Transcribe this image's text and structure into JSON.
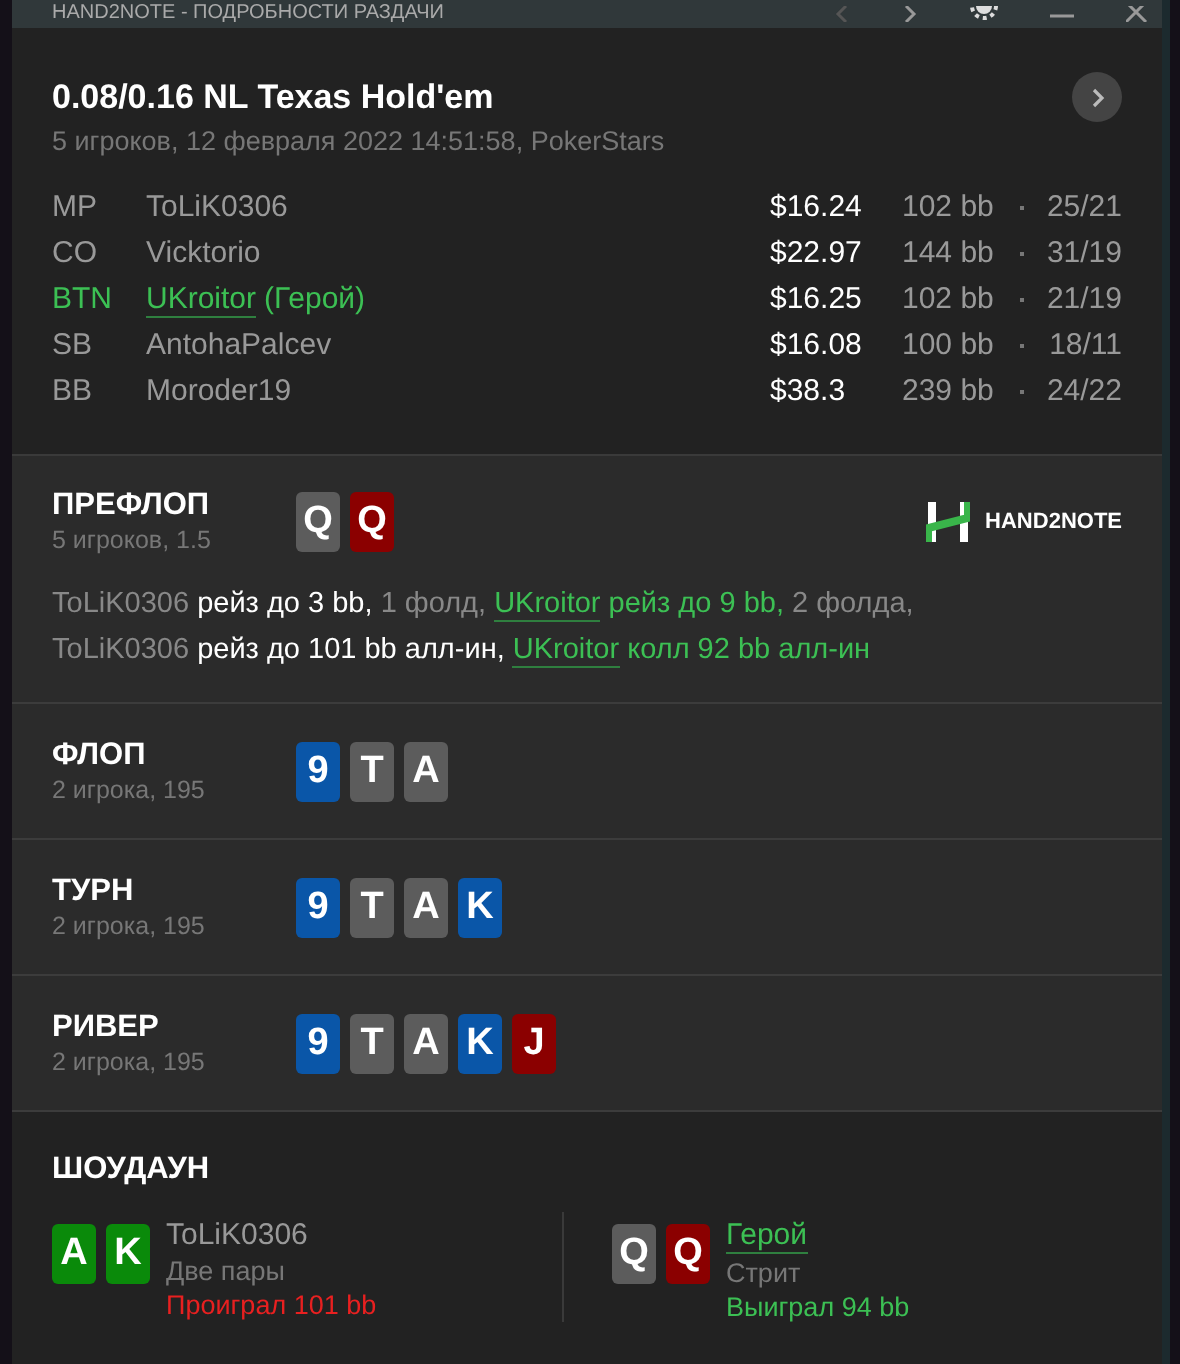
{
  "window": {
    "title": "HAND2NOTE - ПОДРОБНОСТИ РАЗДАЧИ"
  },
  "header": {
    "title": "0.08/0.16 NL Texas Hold'em",
    "subtitle": "5 игроков, 12 февраля 2022 14:51:58, PokerStars"
  },
  "players": [
    {
      "position": "MP",
      "name": "ToLiK0306",
      "hero": false,
      "stack": "$16.24",
      "bb": "102 bb",
      "stats": "25/21"
    },
    {
      "position": "CO",
      "name": "Vicktorio",
      "hero": false,
      "stack": "$22.97",
      "bb": "144 bb",
      "stats": "31/19"
    },
    {
      "position": "BTN",
      "name": "UKroitor",
      "hero": true,
      "hero_label": "(Герой)",
      "stack": "$16.25",
      "bb": "102 bb",
      "stats": "21/19"
    },
    {
      "position": "SB",
      "name": "AntohaPalcev",
      "hero": false,
      "stack": "$16.08",
      "bb": "100 bb",
      "stats": "18/11"
    },
    {
      "position": "BB",
      "name": "Moroder19",
      "hero": false,
      "stack": "$38.3",
      "bb": "239 bb",
      "stats": "24/22"
    }
  ],
  "preflop": {
    "title": "ПРЕФЛОП",
    "subtitle": "5 игроков, 1.5",
    "cards": [
      {
        "rank": "Q",
        "color": "#5c5c5c"
      },
      {
        "rank": "Q",
        "color": "#8b0000"
      }
    ],
    "logo": "HAND2NOTE",
    "action_lines": [
      [
        {
          "kind": "player",
          "text": "ToLiK0306"
        },
        {
          "kind": "action",
          "text": "рейз до 3 bb,"
        },
        {
          "kind": "fold",
          "text": "1 фолд,"
        },
        {
          "kind": "hero",
          "text": "UKroitor"
        },
        {
          "kind": "hero_action",
          "text": "рейз до 9 bb,"
        },
        {
          "kind": "fold",
          "text": "2 фолда,"
        }
      ],
      [
        {
          "kind": "player",
          "text": "ToLiK0306"
        },
        {
          "kind": "action",
          "text": "рейз до 101 bb алл-ин,"
        },
        {
          "kind": "hero",
          "text": "UKroitor"
        },
        {
          "kind": "hero_action",
          "text": "колл 92 bb алл-ин"
        }
      ]
    ]
  },
  "streets": [
    {
      "title": "ФЛОП",
      "subtitle": "2 игрока, 195",
      "cards": [
        {
          "rank": "9",
          "color": "#0a56a8"
        },
        {
          "rank": "T",
          "color": "#5c5c5c"
        },
        {
          "rank": "A",
          "color": "#5c5c5c"
        }
      ]
    },
    {
      "title": "ТУРН",
      "subtitle": "2 игрока, 195",
      "cards": [
        {
          "rank": "9",
          "color": "#0a56a8"
        },
        {
          "rank": "T",
          "color": "#5c5c5c"
        },
        {
          "rank": "A",
          "color": "#5c5c5c"
        },
        {
          "rank": "K",
          "color": "#0a56a8"
        }
      ]
    },
    {
      "title": "РИВЕР",
      "subtitle": "2 игрока, 195",
      "cards": [
        {
          "rank": "9",
          "color": "#0a56a8"
        },
        {
          "rank": "T",
          "color": "#5c5c5c"
        },
        {
          "rank": "A",
          "color": "#5c5c5c"
        },
        {
          "rank": "K",
          "color": "#0a56a8"
        },
        {
          "rank": "J",
          "color": "#8b0000"
        }
      ]
    }
  ],
  "showdown": {
    "title": "ШОУДАУН",
    "hands": [
      {
        "name": "ToLiK0306",
        "hero": false,
        "hand": "Две пары",
        "result": "Проиграл 101 bb",
        "won": false,
        "cards": [
          {
            "rank": "A",
            "color": "#0a8a0a"
          },
          {
            "rank": "K",
            "color": "#0a8a0a"
          }
        ]
      },
      {
        "name": "Герой",
        "hero": true,
        "hand": "Стрит",
        "result": "Выиграл 94 bb",
        "won": true,
        "cards": [
          {
            "rank": "Q",
            "color": "#5c5c5c"
          },
          {
            "rank": "Q",
            "color": "#8b0000"
          }
        ]
      }
    ]
  }
}
